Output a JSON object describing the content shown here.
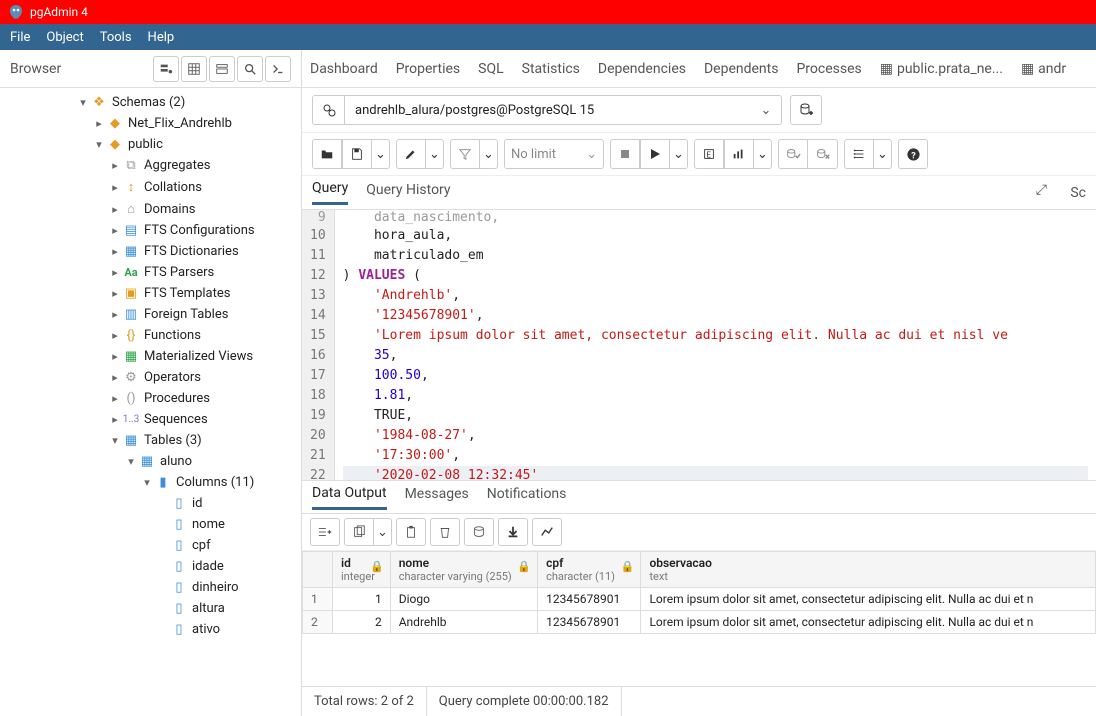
{
  "title": "pgAdmin 4",
  "menus": [
    "File",
    "Object",
    "Tools",
    "Help"
  ],
  "sidebar": {
    "title": "Browser"
  },
  "tree": {
    "schemas": "Schemas (2)",
    "schema1": "Net_Flix_Andrehlb",
    "schema2": "public",
    "aggregates": "Aggregates",
    "collations": "Collations",
    "domains": "Domains",
    "ftsconf": "FTS Configurations",
    "ftsdict": "FTS Dictionaries",
    "ftsparsers": "FTS Parsers",
    "ftstemplates": "FTS Templates",
    "foreigntables": "Foreign Tables",
    "functions": "Functions",
    "matviews": "Materialized Views",
    "operators": "Operators",
    "procedures": "Procedures",
    "sequences": "Sequences",
    "tables": "Tables (3)",
    "aluno": "aluno",
    "columns": "Columns (11)",
    "c_id": "id",
    "c_nome": "nome",
    "c_cpf": "cpf",
    "c_idade": "idade",
    "c_dinheiro": "dinheiro",
    "c_altura": "altura",
    "c_ativo": "ativo"
  },
  "maintabs": {
    "dashboard": "Dashboard",
    "properties": "Properties",
    "sql": "SQL",
    "statistics": "Statistics",
    "dependencies": "Dependencies",
    "dependents": "Dependents",
    "processes": "Processes",
    "qt1": "public.prata_ne...",
    "qt2": "andr"
  },
  "conn": "andrehlb_alura/postgres@PostgreSQL 15",
  "nolimit": "No limit",
  "subtabs": {
    "query": "Query",
    "history": "Query History",
    "sc": "Sc"
  },
  "code": {
    "lines": [
      "    data_nascimento,",
      "    hora_aula,",
      "    matriculado_em",
      ") ",
      "    ",
      "    ",
      "    ",
      "    ",
      "    ",
      "    ",
      "    TRUE,",
      "    ",
      "    ",
      "    "
    ],
    "line9id": "    data_nascimento,",
    "l10": "    hora_aula,",
    "l11": "    matriculado_em",
    "values": "VALUES",
    "paren": " (",
    "s13": "'Andrehlb'",
    "s14": "'12345678901'",
    "s15": "'Lorem ipsum dolor sit amet, consectetur adipiscing elit. Nulla ac dui et nisl ve",
    "n16": "35",
    "n17": "100.50",
    "n18": "1.81",
    "t19": "TRUE",
    "s20": "'1984-08-27'",
    "s21": "'17:30:00'",
    "s22": "'2020-02-08 12:32:45'",
    "comma": ","
  },
  "gutters": [
    "9",
    "10",
    "11",
    "12",
    "13",
    "14",
    "15",
    "16",
    "17",
    "18",
    "19",
    "20",
    "21",
    "22"
  ],
  "outputtabs": {
    "data": "Data Output",
    "messages": "Messages",
    "notifications": "Notifications"
  },
  "cols": {
    "id": {
      "name": "id",
      "type": "integer"
    },
    "nome": {
      "name": "nome",
      "type": "character varying (255)"
    },
    "cpf": {
      "name": "cpf",
      "type": "character (11)"
    },
    "obs": {
      "name": "observacao",
      "type": "text"
    }
  },
  "rows": [
    {
      "n": "1",
      "id": "1",
      "nome": "Diogo",
      "cpf": "12345678901",
      "obs": "Lorem ipsum dolor sit amet, consectetur adipiscing elit. Nulla ac dui et n"
    },
    {
      "n": "2",
      "id": "2",
      "nome": "Andrehlb",
      "cpf": "12345678901",
      "obs": "Lorem ipsum dolor sit amet, consectetur adipiscing elit. Nulla ac dui et n"
    }
  ],
  "status": {
    "rows": "Total rows: 2 of 2",
    "time": "Query complete 00:00:00.182"
  }
}
